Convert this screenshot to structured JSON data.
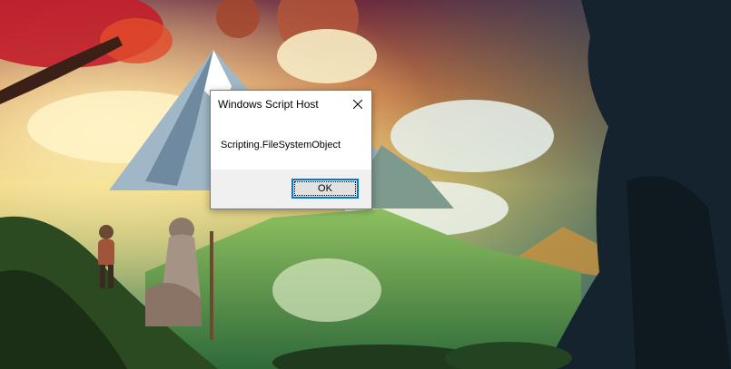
{
  "desktop": {
    "wallpaper": "fantasy-landscape-wallpaper"
  },
  "dialog": {
    "title": "Windows Script Host",
    "close_icon": "close-icon",
    "message": "Scripting.FileSystemObject",
    "ok_label": "OK"
  },
  "colors": {
    "dialog_bg": "#ffffff",
    "footer_bg": "#f0f0f0",
    "button_border": "#0078d7"
  }
}
